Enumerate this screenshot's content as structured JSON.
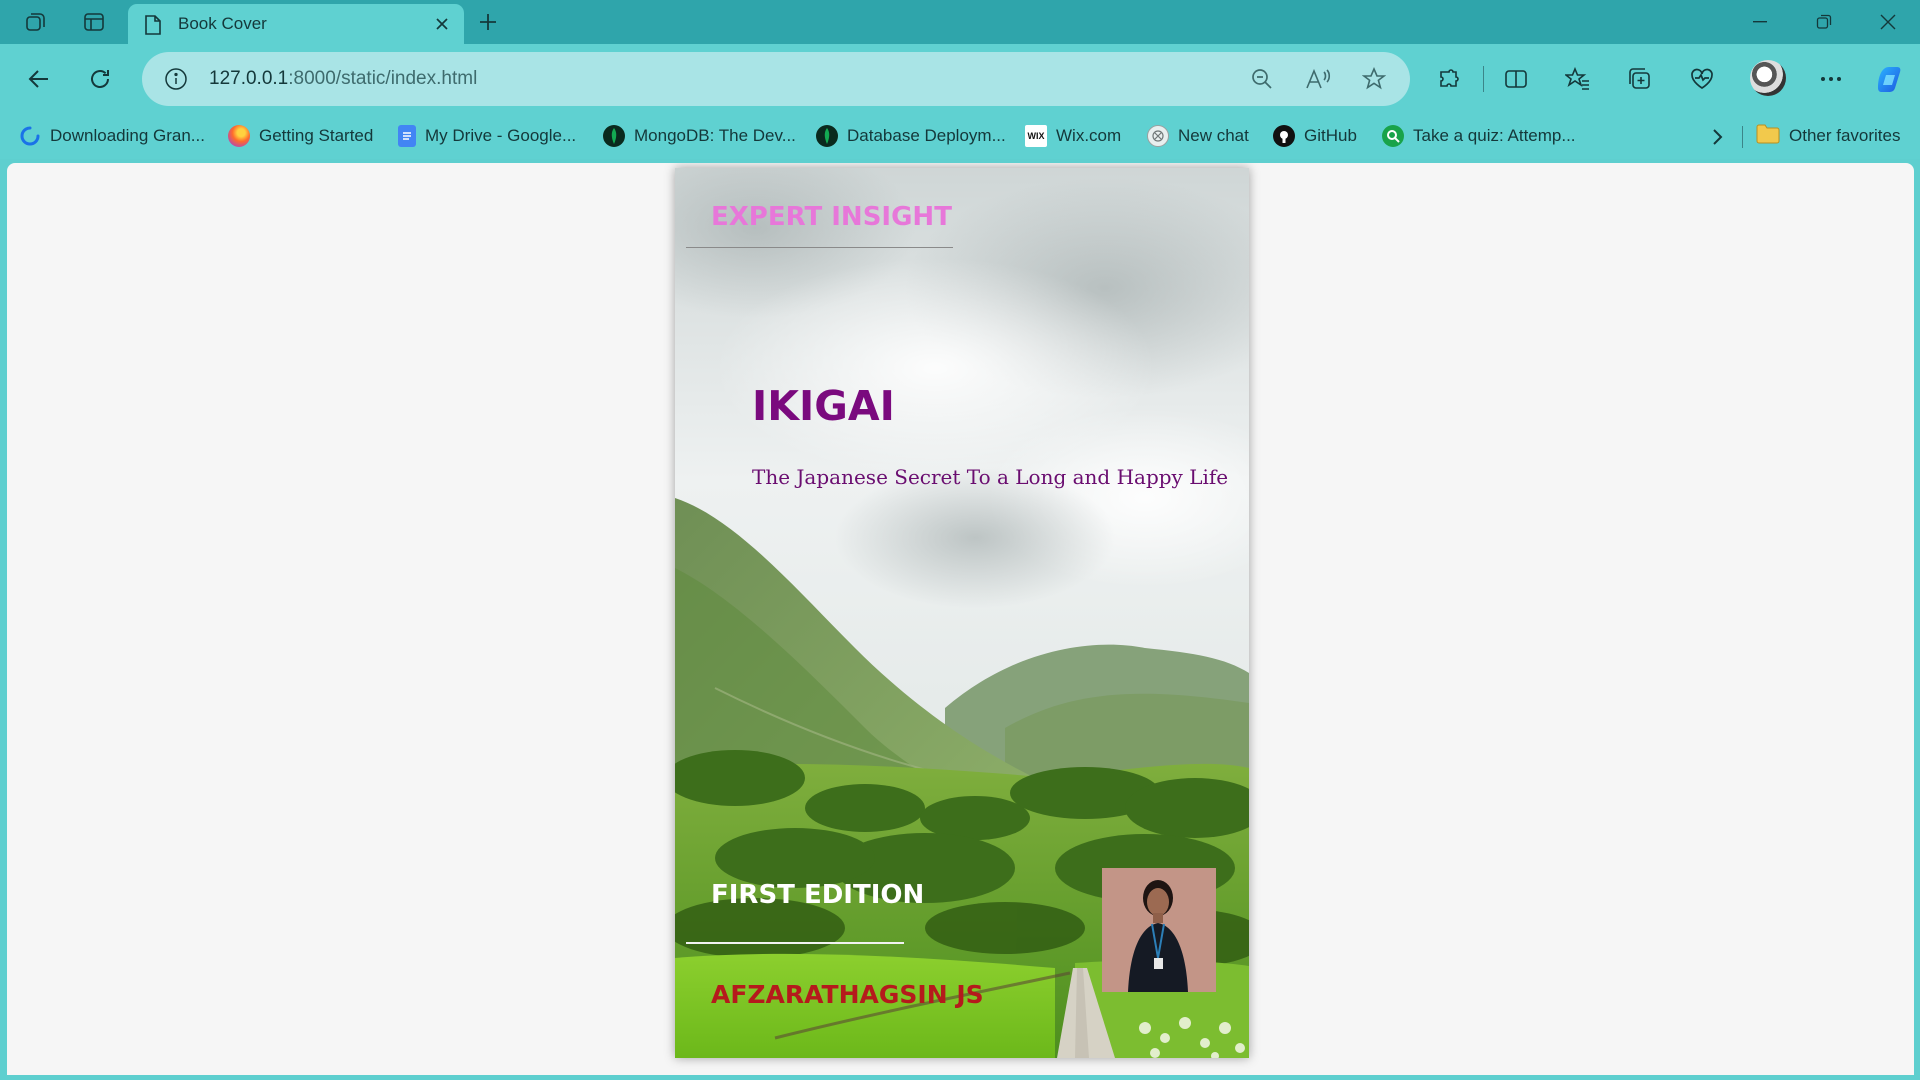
{
  "browser": {
    "tab": {
      "title": "Book Cover"
    },
    "address": {
      "host": "127.0.0.1",
      "rest": ":8000/static/index.html"
    },
    "favorites": [
      {
        "label": "Downloading Gran...",
        "icon": "loading-icon",
        "color": "#1a73e8"
      },
      {
        "label": "Getting Started",
        "icon": "firefox-icon",
        "color": "#ff6b2c"
      },
      {
        "label": "My Drive - Google...",
        "icon": "google-docs-icon",
        "color": "#4285f4"
      },
      {
        "label": "MongoDB: The Dev...",
        "icon": "mongodb-icon",
        "color": "#0a2a1e"
      },
      {
        "label": "Database Deploym...",
        "icon": "mongodb-icon",
        "color": "#0a2a1e"
      },
      {
        "label": "Wix.com",
        "icon": "wix-icon",
        "color": "#ffffff"
      },
      {
        "label": "New chat",
        "icon": "openai-icon",
        "color": "#9aa0a0"
      },
      {
        "label": "GitHub",
        "icon": "github-icon",
        "color": "#111111"
      },
      {
        "label": "Take a quiz: Attemp...",
        "icon": "quiz-icon",
        "color": "#19a34a"
      }
    ],
    "other_favorites": "Other favorites"
  },
  "cover": {
    "series": "EXPERT INSIGHT",
    "title": "IKIGAI",
    "subtitle": "The Japanese Secret To a Long and Happy Life",
    "edition": "FIRST EDITION",
    "author": "AFZARATHAGSIN JS",
    "colors": {
      "series": "#e777d9",
      "title": "#7a0a7e",
      "author": "#b51a1c"
    }
  }
}
